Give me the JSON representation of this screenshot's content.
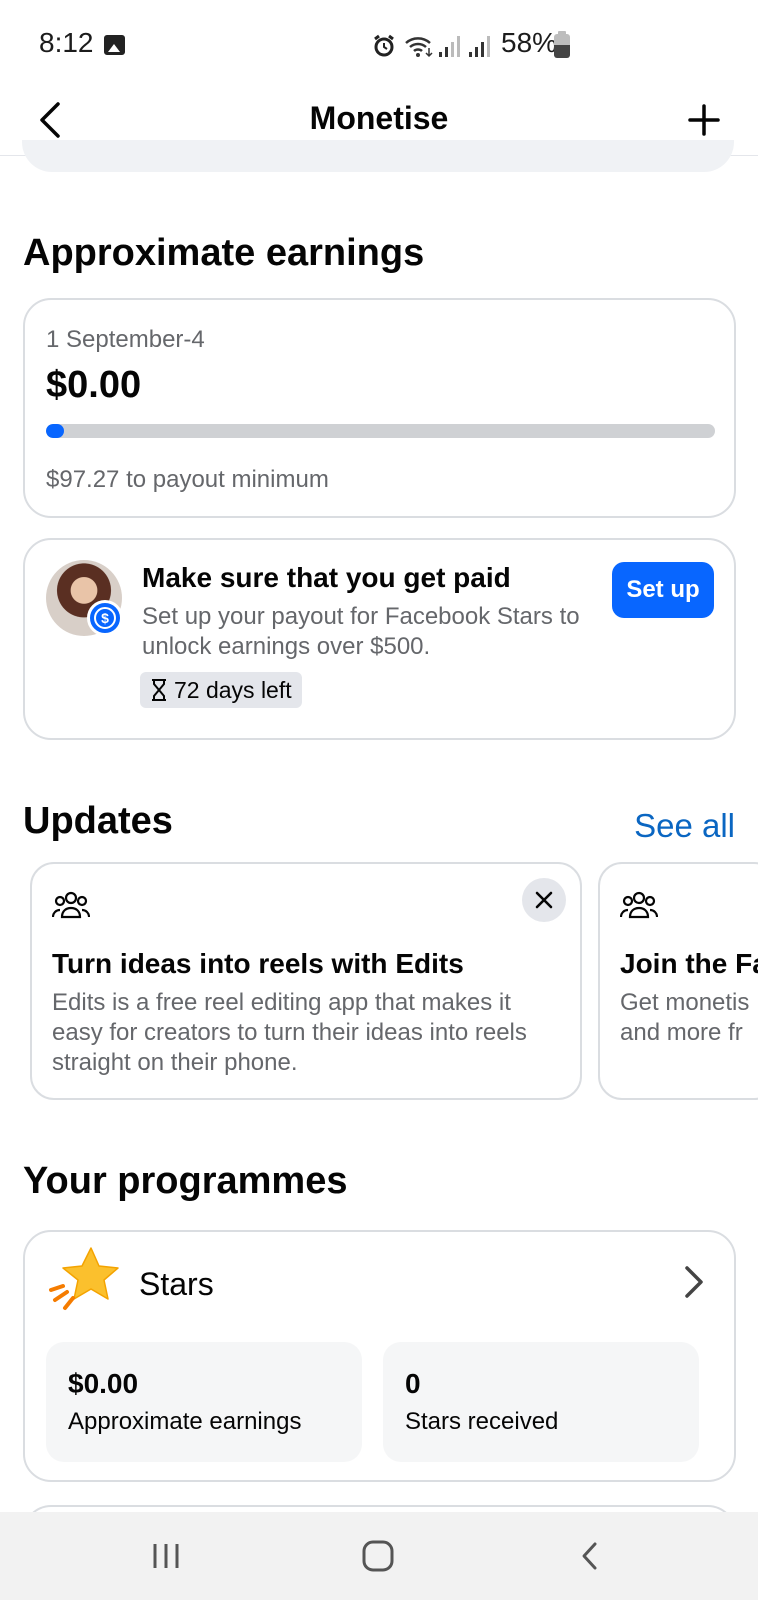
{
  "status_bar": {
    "time": "8:12",
    "battery": "58%",
    "icons": [
      "gallery-icon",
      "alarm-icon",
      "wifi-icon",
      "signal-icon",
      "signal-icon",
      "battery-icon"
    ]
  },
  "header": {
    "title": "Monetise",
    "back_icon": "back-arrow-icon",
    "add_icon": "plus-icon"
  },
  "earnings": {
    "section_title": "Approximate earnings",
    "period": "1 September-4",
    "amount": "$0.00",
    "progress_fraction": 0.02,
    "payout_note": "$97.27 to payout minimum"
  },
  "payout_card": {
    "title": "Make sure that you get paid",
    "description": "Set up your payout for Facebook Stars to unlock earnings over $500.",
    "days_left": "72 days left",
    "button_label": "Set up"
  },
  "updates": {
    "section_title": "Updates",
    "see_all": "See all",
    "cards": [
      {
        "title": "Turn ideas into reels with Edits",
        "description": "Edits is a free reel editing app that makes it easy for creators to turn their ideas into reels straight on their phone."
      },
      {
        "title": "Join the Fa",
        "description": "Get monetis and more fr"
      }
    ]
  },
  "programmes": {
    "section_title": "Your programmes",
    "stars": {
      "label": "Stars",
      "earnings_value": "$0.00",
      "earnings_label": "Approximate earnings",
      "received_value": "0",
      "received_label": "Stars received"
    }
  },
  "colors": {
    "accent": "#0866ff",
    "link": "#0a66c2",
    "secondary_text": "#65676b",
    "border": "#dadde1"
  }
}
